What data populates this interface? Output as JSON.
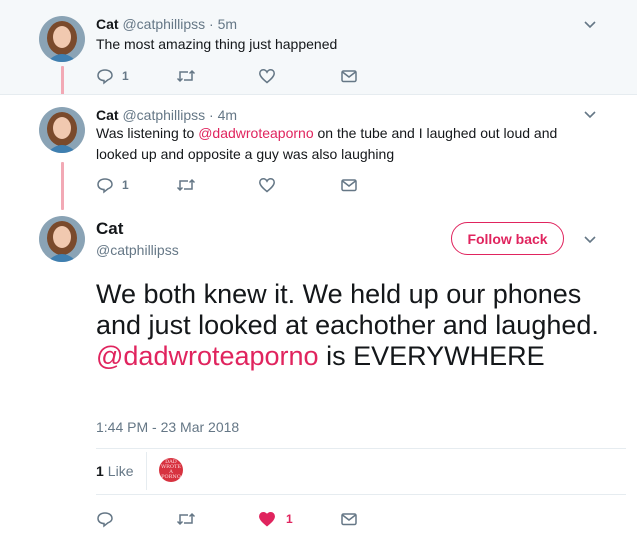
{
  "tweets": [
    {
      "name": "Cat",
      "handle": "@catphillipss",
      "sep": "·",
      "time": "5m",
      "text": "The most amazing thing just happened",
      "reply_count": "1"
    },
    {
      "name": "Cat",
      "handle": "@catphillipss",
      "sep": "·",
      "time": "4m",
      "text_before": "Was listening to ",
      "mention": "@dadwroteaporno",
      "text_after": " on the tube and I laughed out loud and looked up and opposite a guy was also laughing",
      "reply_count": "1"
    }
  ],
  "main_tweet": {
    "name": "Cat",
    "handle": "@catphillipss",
    "follow_label": "Follow back",
    "text_before": "We both knew it. We held up our phones and just looked at eachother and laughed. ",
    "mention": "@dadwroteaporno",
    "text_after": " is EVERYWHERE",
    "timestamp": "1:44 PM - 23 Mar 2018",
    "like_count_bold": "1",
    "like_word": "Like",
    "liker_avatar_text": "DAD WROTE A PORNO",
    "action_like_count": "1"
  },
  "colors": {
    "accent": "#e0245e",
    "thread_line": "#f2a9b5",
    "muted": "#657786",
    "top_bg": "#f5f8fa"
  },
  "icons": [
    "reply-icon",
    "retweet-icon",
    "heart-icon",
    "message-icon",
    "chevron-down-icon"
  ]
}
